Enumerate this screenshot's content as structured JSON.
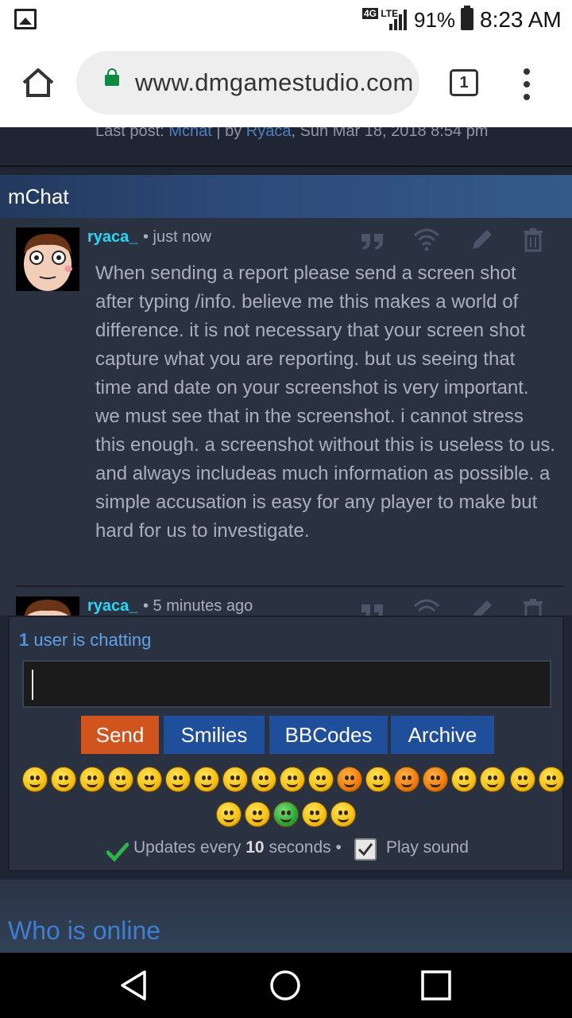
{
  "status_bar": {
    "network_badge": "4G",
    "network_type": "LTE",
    "battery_percent": "91%",
    "time": "8:23 AM"
  },
  "browser": {
    "url": "www.dmgamestudio.com",
    "tab_count": "1"
  },
  "forum": {
    "last_post_label": "Last post:",
    "last_post_topic": "Mchat",
    "last_post_by_label": "by",
    "last_post_author": "Ryaca",
    "last_post_date": ", Sun Mar 18, 2018 8:54 pm"
  },
  "mchat": {
    "title": "mChat",
    "messages": [
      {
        "username": "ryaca_",
        "time": "• just now",
        "text": "When sending a report please send a screen shot after typing /info. believe me this makes a world of difference. it is not necessary that your screen shot capture what you are reporting. but us seeing that time and date on your screenshot is very important. we must see that in the screenshot. i cannot stress this enough. a screenshot without this is useless to us. and always includeas much information as possible. a simple accusation is easy for any player to make but hard for us to investigate."
      },
      {
        "username": "ryaca_",
        "time": "• 5 minutes ago"
      }
    ],
    "users_chatting_count": "1",
    "users_chatting_text": "user is chatting",
    "input_value": "",
    "buttons": {
      "send": "Send",
      "smilies": "Smilies",
      "bbcodes": "BBCodes",
      "archive": "Archive"
    },
    "updates_prefix": "Updates every",
    "updates_interval": "10",
    "updates_suffix": "seconds •",
    "play_sound_label": "Play sound",
    "play_sound_checked": true
  },
  "who_is_online": "Who is online",
  "colors": {
    "username": "#2ad6f2",
    "send_button": "#d0541e",
    "blue_button": "#1f4f9a",
    "link": "#3f7ed1"
  }
}
